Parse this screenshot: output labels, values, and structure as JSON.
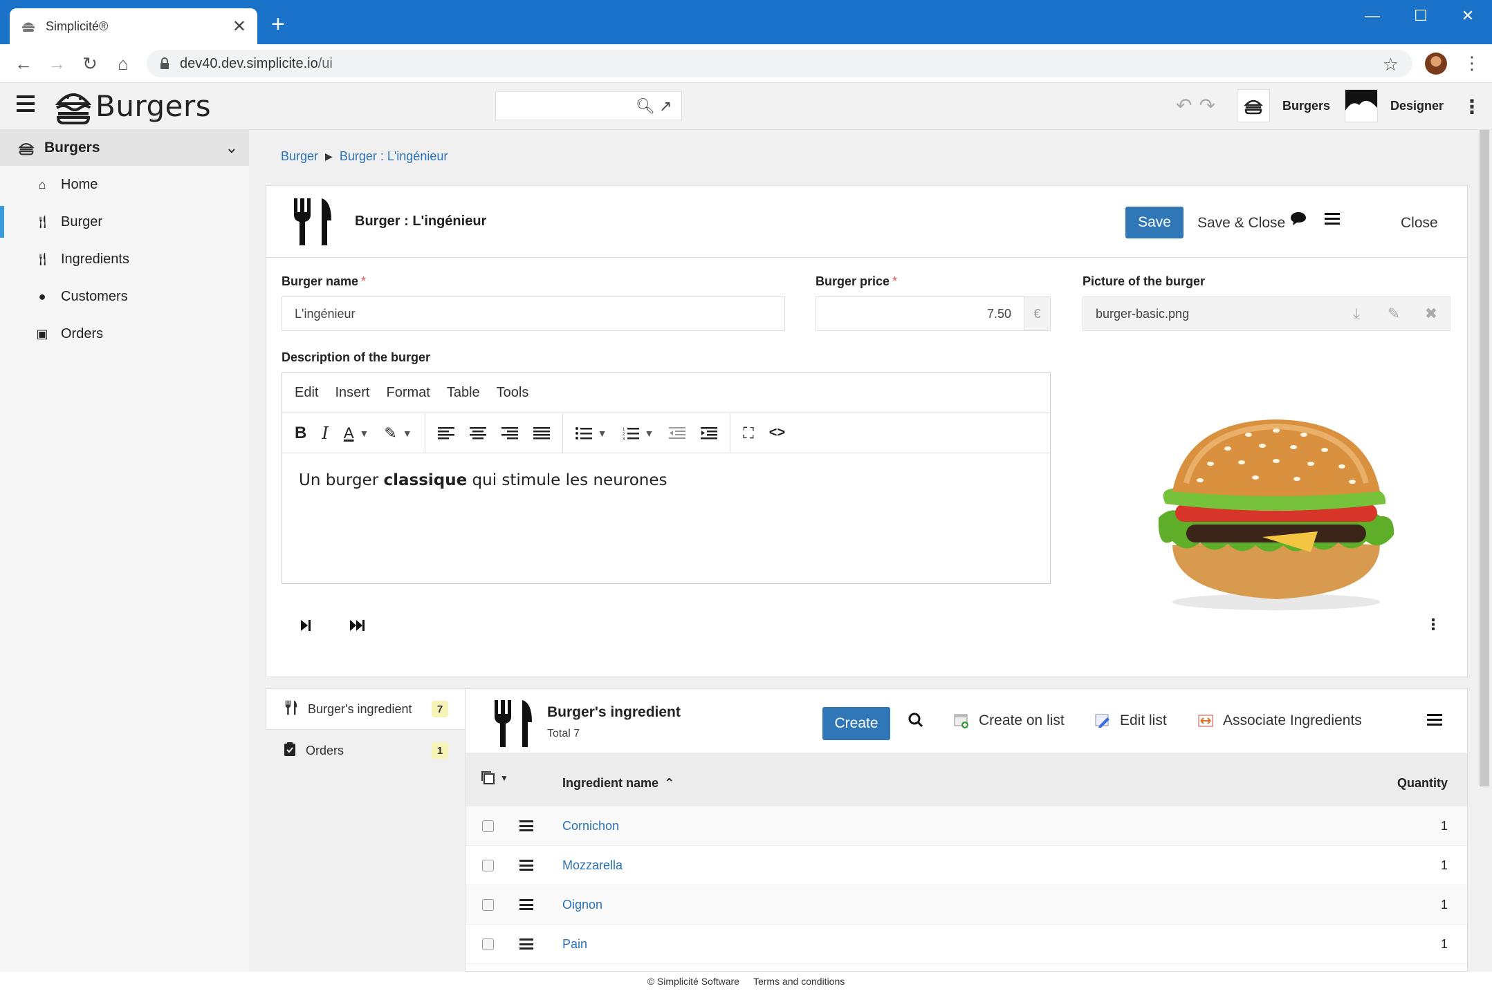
{
  "browser": {
    "tab_title": "Simplicité®",
    "url_host": "dev40.dev.simplicite.io",
    "url_path": "/ui"
  },
  "header": {
    "app_name": "Burgers",
    "scopes": [
      {
        "label": "Burgers"
      },
      {
        "label": "Designer"
      }
    ]
  },
  "sidebar": {
    "title": "Burgers",
    "items": [
      {
        "label": "Home",
        "icon": "home-icon"
      },
      {
        "label": "Burger",
        "icon": "utensils-icon"
      },
      {
        "label": "Ingredients",
        "icon": "utensils-icon"
      },
      {
        "label": "Customers",
        "icon": "user-icon"
      },
      {
        "label": "Orders",
        "icon": "clipboard-icon"
      }
    ]
  },
  "breadcrumb": {
    "root": "Burger",
    "current": "Burger : L'ingénieur"
  },
  "form": {
    "title": "Burger : L'ingénieur",
    "save_label": "Save",
    "save_close_label": "Save & Close",
    "close_label": "Close",
    "name_label": "Burger name",
    "name_value": "L'ingénieur",
    "price_label": "Burger price",
    "price_value": "7.50",
    "price_unit": "€",
    "picture_label": "Picture of the burger",
    "picture_file": "burger-basic.png",
    "description_label": "Description of the burger",
    "required_mark": "*"
  },
  "editor": {
    "menu": [
      "Edit",
      "Insert",
      "Format",
      "Table",
      "Tools"
    ],
    "content_before": "Un burger ",
    "content_bold": "classique",
    "content_after": " qui stimule les neurones"
  },
  "subtabs": [
    {
      "label": "Burger's ingredient",
      "count": "7"
    },
    {
      "label": "Orders",
      "count": "1"
    }
  ],
  "list": {
    "title": "Burger's ingredient",
    "total": "Total 7",
    "create_label": "Create",
    "create_on_list_label": "Create on list",
    "edit_list_label": "Edit list",
    "associate_label": "Associate Ingredients",
    "col_name": "Ingredient name",
    "col_qty": "Quantity",
    "rows": [
      {
        "name": "Cornichon",
        "qty": "1"
      },
      {
        "name": "Mozzarella",
        "qty": "1"
      },
      {
        "name": "Oignon",
        "qty": "1"
      },
      {
        "name": "Pain",
        "qty": "1"
      }
    ]
  },
  "footer": {
    "copyright": "© Simplicité Software",
    "terms": "Terms and conditions"
  },
  "colors": {
    "browser_chrome": "#1a73c9",
    "primary": "#2f77b7",
    "link": "#2a72b6",
    "active_marker": "#3a9bd9",
    "badge": "#f6f3b6"
  }
}
